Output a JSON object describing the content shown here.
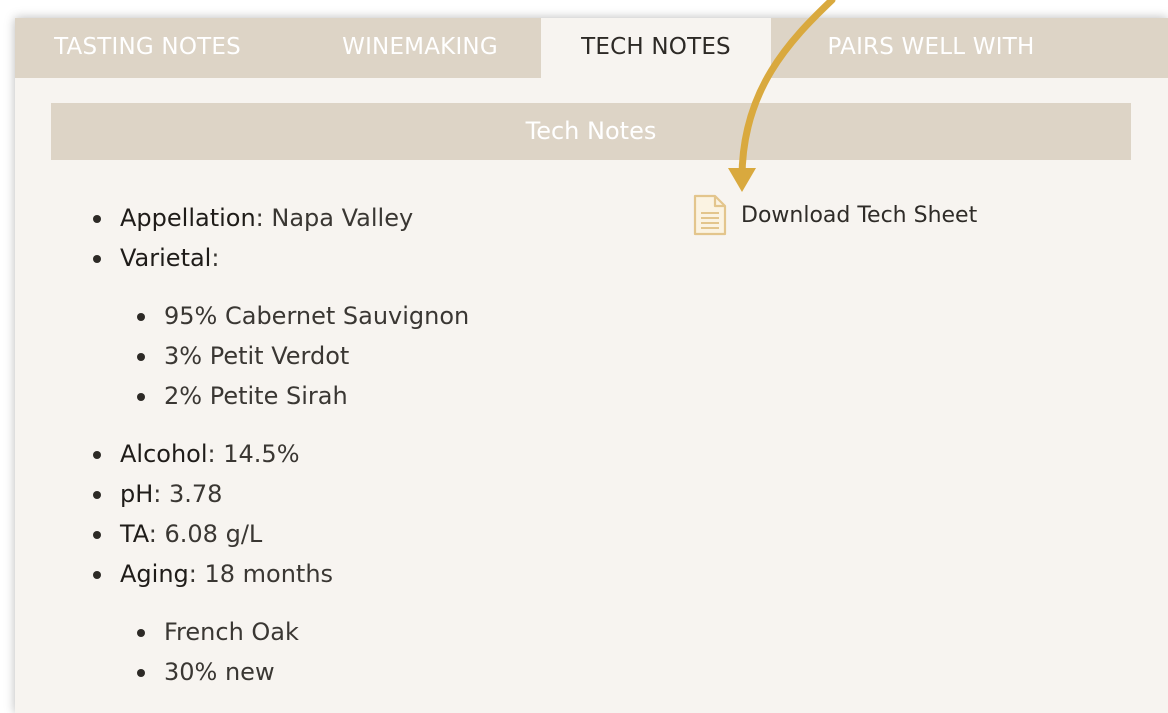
{
  "tabs": [
    {
      "label": "TASTING NOTES",
      "active": false
    },
    {
      "label": "WINEMAKING",
      "active": false
    },
    {
      "label": "TECH NOTES",
      "active": true
    },
    {
      "label": "PAIRS WELL WITH",
      "active": false
    }
  ],
  "section": {
    "title": "Tech Notes"
  },
  "specs": {
    "appellation": {
      "key": "Appellation",
      "value": "Napa Valley"
    },
    "varietal": {
      "key": "Varietal",
      "items": [
        "95% Cabernet Sauvignon",
        "3% Petit Verdot",
        "2% Petite Sirah"
      ]
    },
    "alcohol": {
      "key": "Alcohol",
      "value": "14.5%"
    },
    "ph": {
      "key": "pH",
      "value": "3.78"
    },
    "ta": {
      "key": "TA",
      "value": "6.08 g/L"
    },
    "aging": {
      "key": "Aging",
      "value": "18 months",
      "items": [
        "French Oak",
        "30% new"
      ]
    }
  },
  "download": {
    "label": "Download Tech Sheet",
    "icon": "document-icon"
  },
  "colors": {
    "tab_bar": "#ddd4c6",
    "panel_bg": "#f7f4f0",
    "arrow": "#d9a93e",
    "icon": "#e3c58c"
  }
}
